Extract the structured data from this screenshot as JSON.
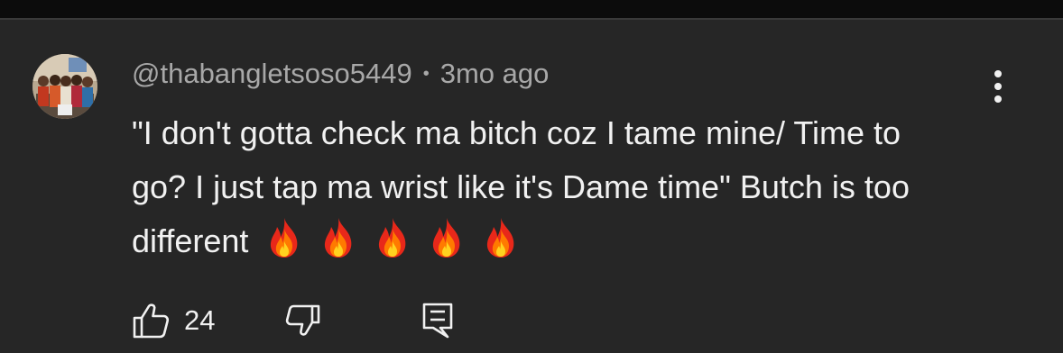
{
  "comment": {
    "username": "@thabangletsoso5449",
    "separator": "•",
    "timestamp": "3mo ago",
    "text": "\"I don't gotta check ma bitch coz I tame mine/ Time to go? I just tap ma wrist like it's Dame time\" Butch is too different",
    "emojis": [
      "fire-emoji",
      "fire-emoji",
      "fire-emoji",
      "fire-emoji",
      "fire-emoji"
    ]
  },
  "actions": {
    "like_count": "24",
    "like_icon": "thumbs-up-icon",
    "dislike_icon": "thumbs-down-icon",
    "reply_icon": "reply-icon",
    "more_icon": "more-vertical-icon"
  },
  "colors": {
    "background": "#262626",
    "text_primary": "#f1f1f1",
    "text_secondary": "#a8a8a8",
    "fire_orange": "#ff7a00",
    "fire_red": "#e8281a",
    "fire_yellow": "#ffd21f"
  }
}
